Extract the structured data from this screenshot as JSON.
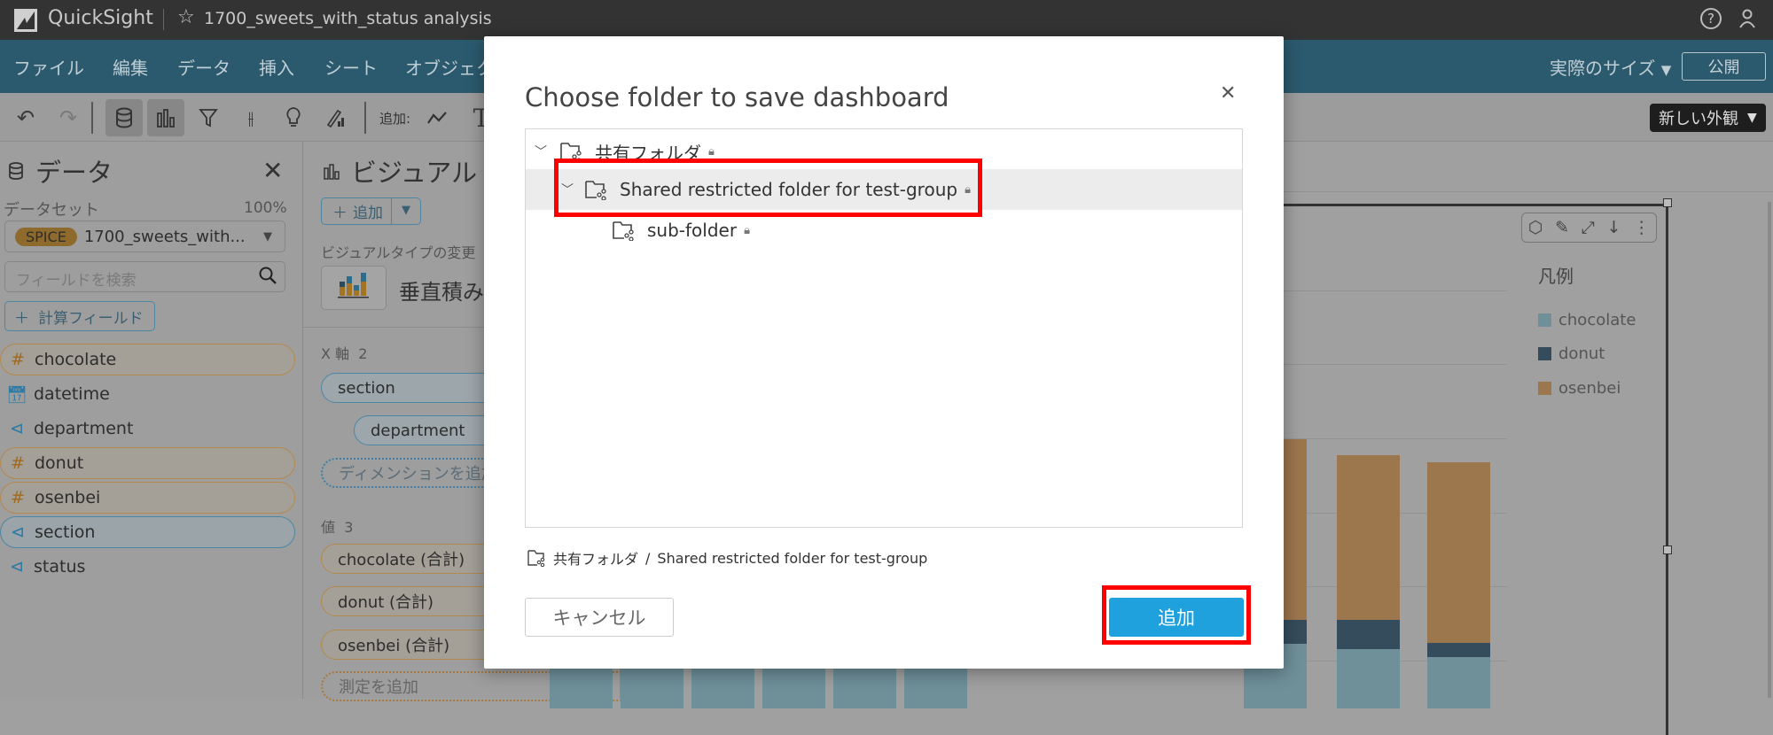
{
  "topbar": {
    "app_name": "QuickSight",
    "analysis_title": "1700_sweets_with_status analysis"
  },
  "menubar": {
    "items": [
      "ファイル",
      "編集",
      "データ",
      "挿入",
      "シート",
      "オブジェク"
    ],
    "zoom_label": "実際のサイズ",
    "publish_label": "公開"
  },
  "toolbar": {
    "add_label": "追加:",
    "appearance_label": "新しい外観"
  },
  "data_panel": {
    "title": "データ",
    "dataset_label": "データセット",
    "dataset_percent": "100%",
    "spice_badge": "SPICE",
    "dataset_name": "1700_sweets_with...",
    "search_placeholder": "フィールドを検索",
    "calc_field_label": "計算フィールド",
    "fields": [
      {
        "name": "chocolate",
        "type": "number"
      },
      {
        "name": "datetime",
        "type": "date"
      },
      {
        "name": "department",
        "type": "dimension"
      },
      {
        "name": "donut",
        "type": "number"
      },
      {
        "name": "osenbei",
        "type": "number"
      },
      {
        "name": "section",
        "type": "dimension"
      },
      {
        "name": "status",
        "type": "dimension"
      }
    ]
  },
  "visual_panel": {
    "title": "ビジュアル",
    "add_label": "追加",
    "change_type_label": "ビジュアルタイプの変更",
    "visual_type": "垂直積み上",
    "x_axis_label": "X 軸",
    "x_axis_count": "2",
    "x_fields": [
      "section",
      "department"
    ],
    "add_dimension": "ディメンションを追加",
    "values_label": "値",
    "values_count": "3",
    "value_fields": [
      "chocolate (合計)",
      "donut (合計)",
      "osenbei (合計)"
    ],
    "add_measure": "測定を追加"
  },
  "chart": {
    "legend_title": "凡例",
    "legend": [
      {
        "name": "chocolate",
        "color": "#6f8f99"
      },
      {
        "name": "donut",
        "color": "#354c5c"
      },
      {
        "name": "osenbei",
        "color": "#9c764d"
      }
    ]
  },
  "dialog": {
    "title": "Choose folder to save dashboard",
    "tree": [
      {
        "label": "共有フォルダ",
        "locked": true,
        "expanded": true
      },
      {
        "label": "Shared restricted folder for test-group",
        "locked": true,
        "expanded": true,
        "selected": true
      },
      {
        "label": "sub-folder",
        "locked": true
      }
    ],
    "breadcrumb": {
      "root": "共有フォルダ",
      "separator": "/",
      "current": "Shared restricted folder for test-group"
    },
    "cancel_label": "キャンセル",
    "add_label": "追加",
    "primary_color": "#1ea1dc",
    "highlight_color": "#ff0000"
  }
}
